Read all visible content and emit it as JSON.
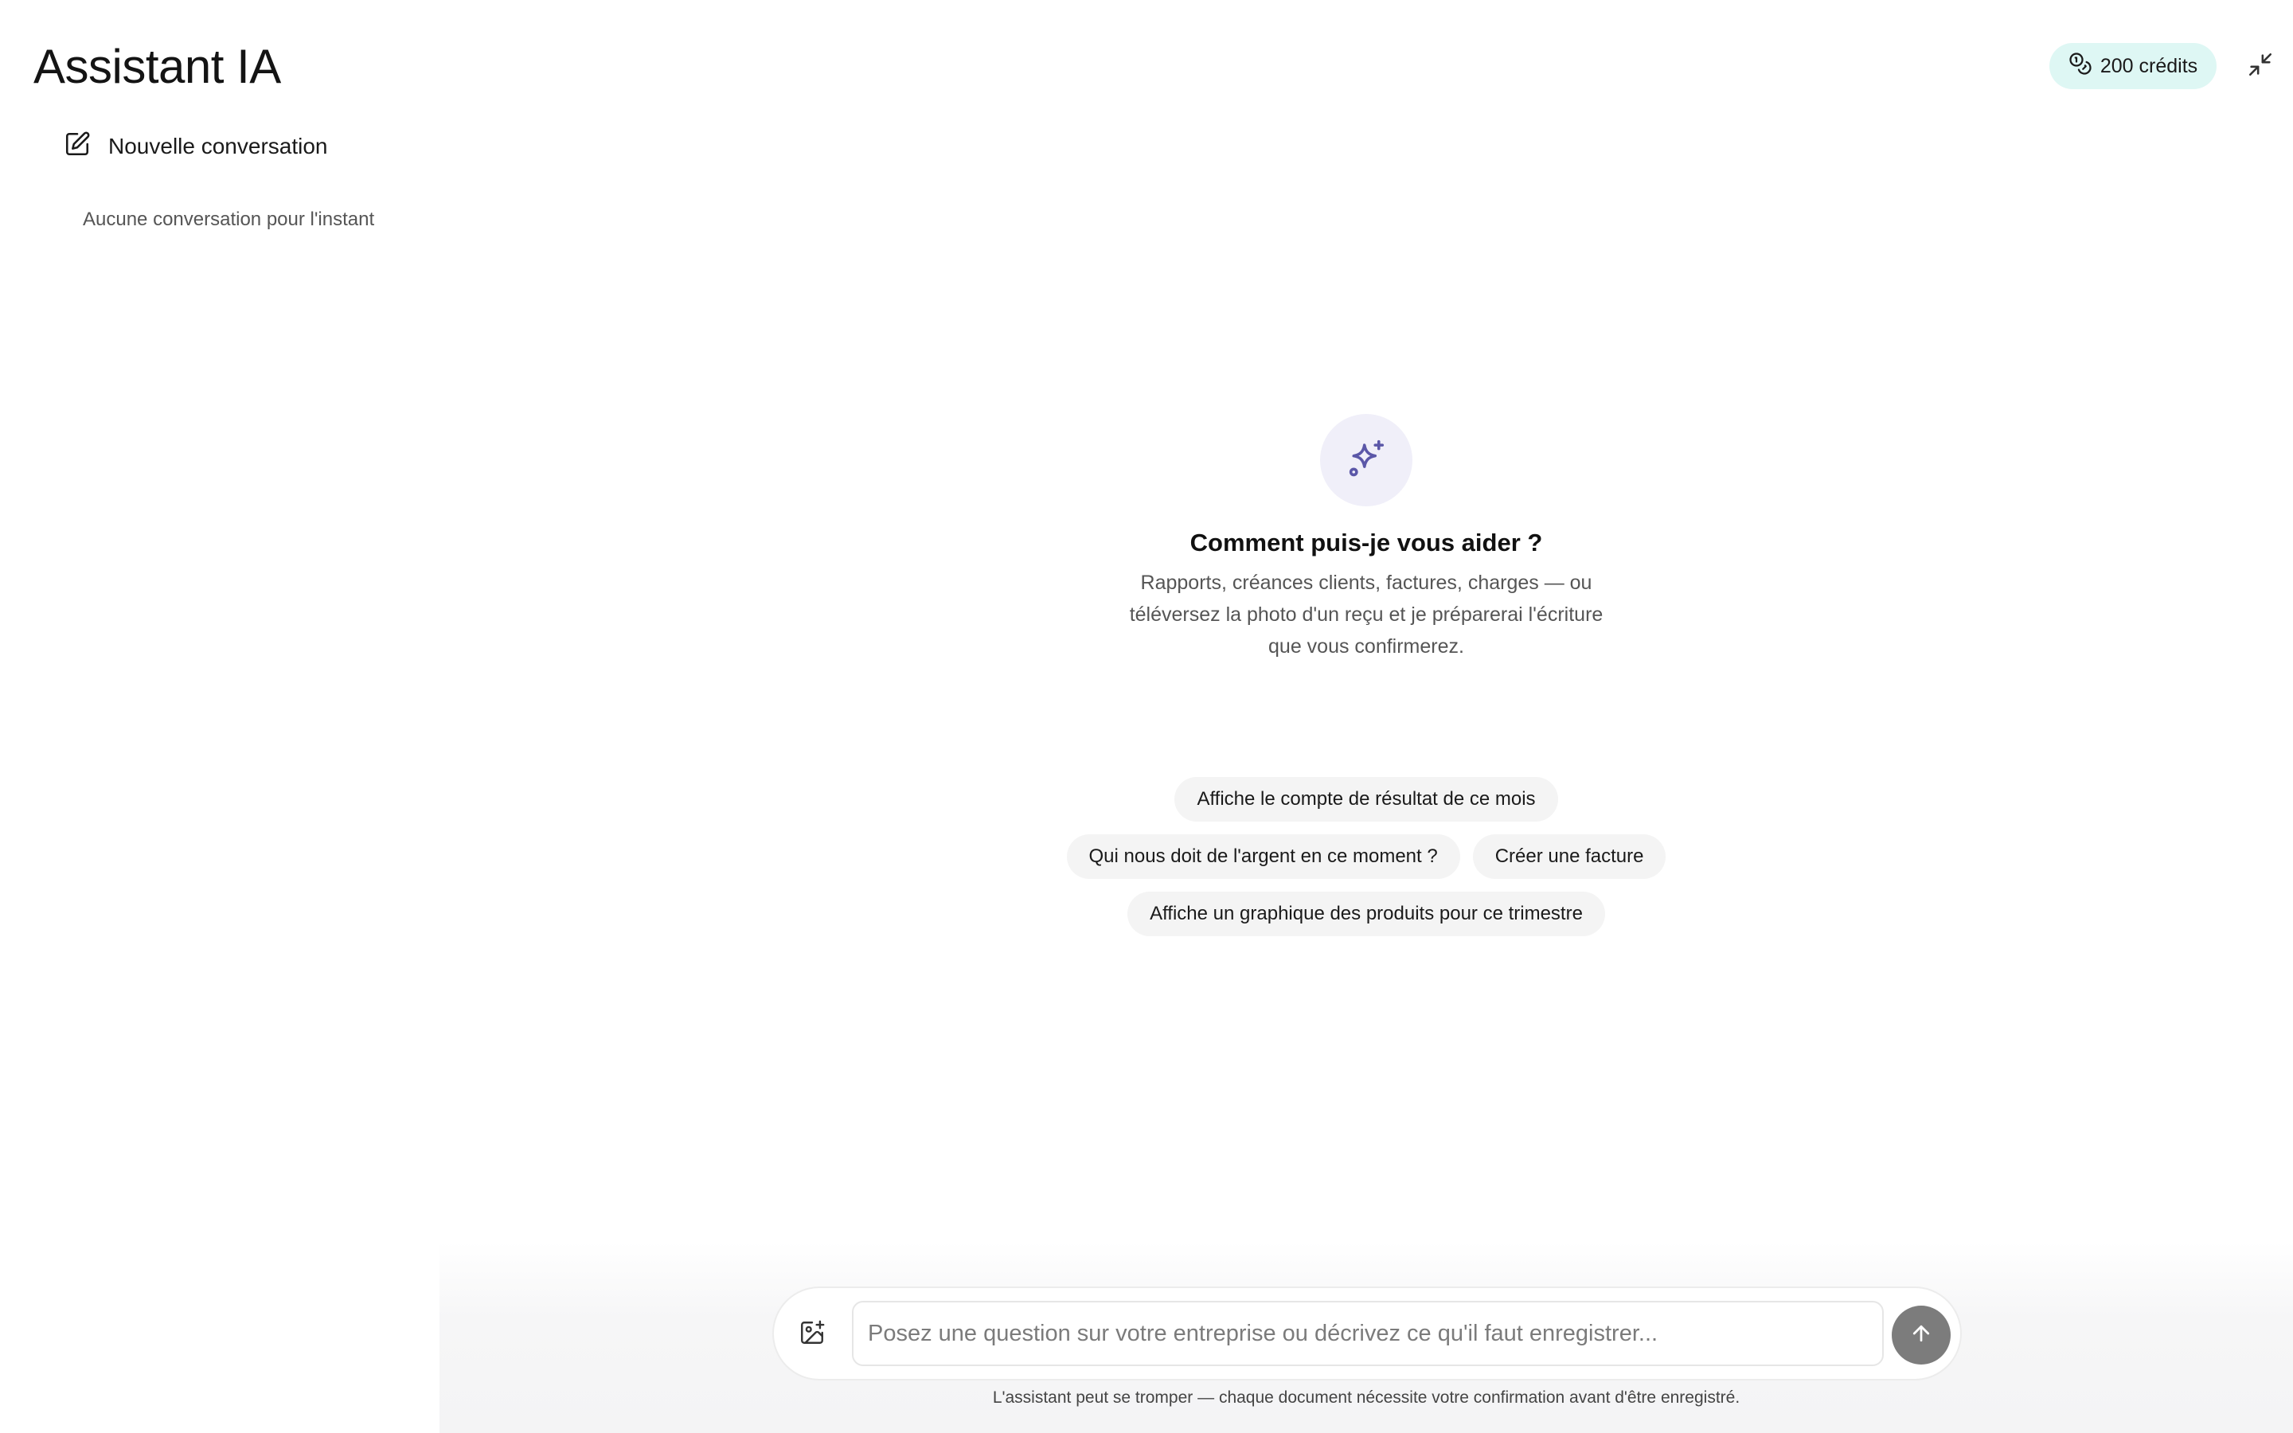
{
  "header": {
    "title": "Assistant IA",
    "credits_label": "200 crédits"
  },
  "sidebar": {
    "new_conversation_label": "Nouvelle conversation",
    "empty_state": "Aucune conversation pour l'instant"
  },
  "main": {
    "welcome_title": "Comment puis-je vous aider ?",
    "welcome_description": "Rapports, créances clients, factures, charges — ou téléversez la photo d'un reçu et je préparerai l'écriture que vous confirmerez.",
    "suggestions": [
      "Affiche le compte de résultat de ce mois",
      "Qui nous doit de l'argent en ce moment ?",
      "Créer une facture",
      "Affiche un graphique des produits pour ce trimestre"
    ]
  },
  "composer": {
    "placeholder": "Posez une question sur votre entreprise ou décrivez ce qu'il faut enregistrer...",
    "value": "",
    "disclaimer": "L'assistant peut se tromper — chaque document nécessite votre confirmation avant d'être enregistré."
  },
  "icons": {
    "credits": "coins-icon",
    "collapse": "minimize-icon",
    "new_conversation": "edit-icon",
    "hero": "sparkles-icon",
    "attach": "image-plus-icon",
    "send": "arrow-up-icon"
  },
  "colors": {
    "credits_badge_bg": "#def7f4",
    "hero_icon_bg": "#f0eff9",
    "hero_icon": "#5b57a8",
    "chip_bg": "#f4f4f4",
    "send_button_bg": "#7c7c7c"
  }
}
